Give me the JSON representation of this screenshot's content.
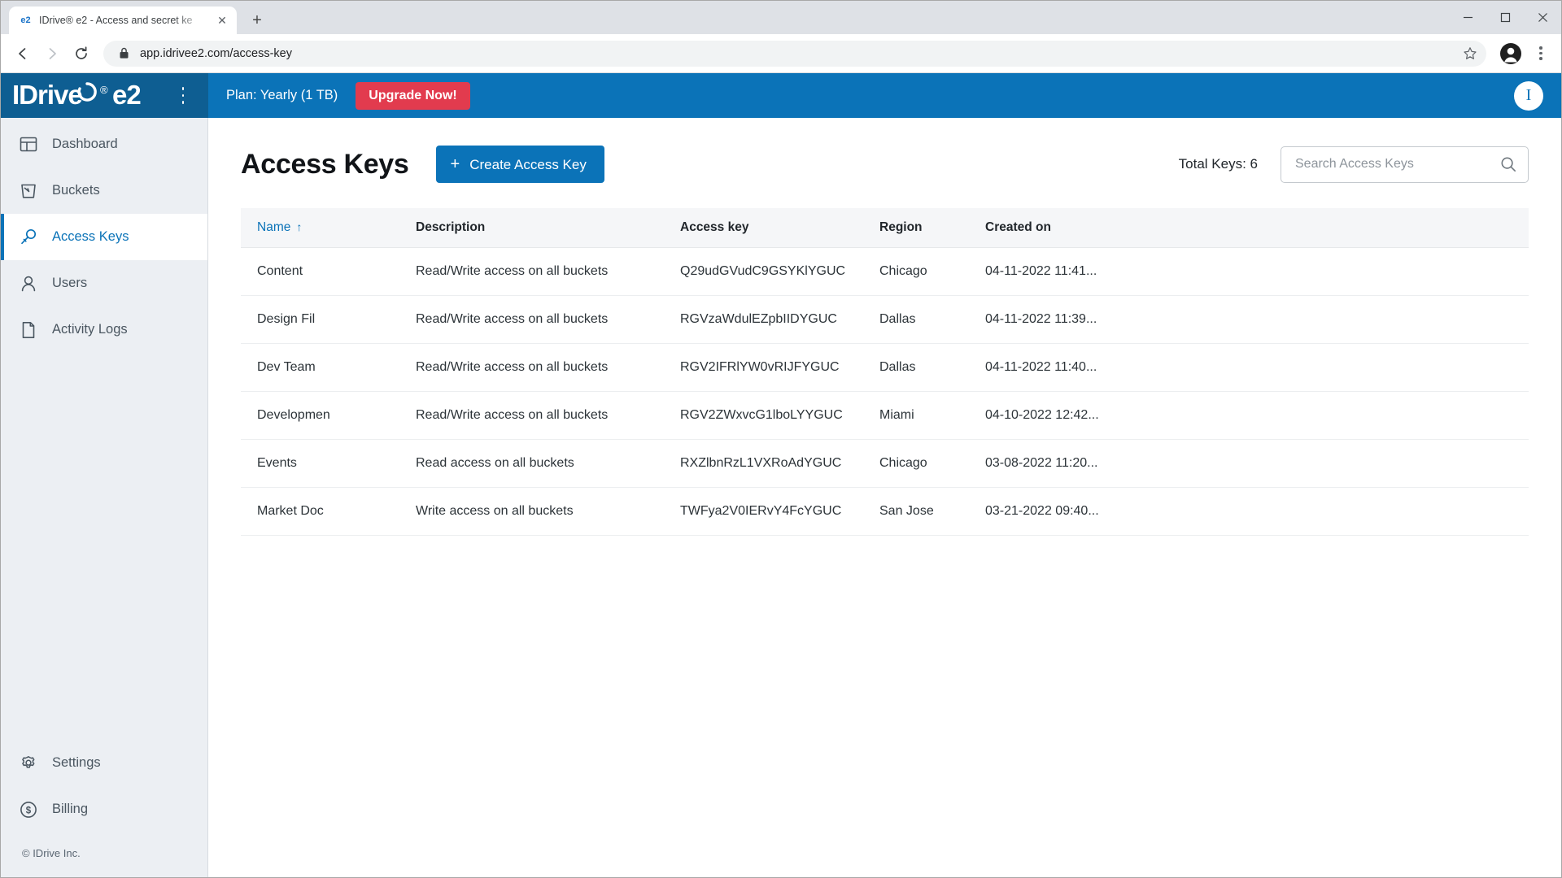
{
  "browser": {
    "tab": {
      "favicon_text": "e2",
      "title": "IDrive® e2 - Access and secret ke",
      "close_label": "✕"
    },
    "new_tab_label": "+",
    "window_controls": {
      "minimize": "—",
      "maximize": "▢",
      "close": "✕"
    },
    "nav": {
      "back": "←",
      "forward": "→",
      "reload": "⟳"
    },
    "url": "app.idrivee2.com/access-key",
    "lock_icon": "lock-icon",
    "bookmark_icon": "star-icon",
    "profile_icon": "profile-avatar-icon",
    "menu_icon": "three-dot-menu-icon"
  },
  "appbar": {
    "logo_text": "IDrive",
    "logo_registered": "®",
    "logo_suffix": "e2",
    "menu_icon": "hamburger-icon",
    "plan_text": "Plan: Yearly (1 TB)",
    "upgrade_label": "Upgrade Now!",
    "avatar_initial": "I",
    "colors": {
      "bar": "#0b73b8",
      "brand_zone": "#0e5e92",
      "upgrade": "#e23b4e"
    }
  },
  "sidebar": {
    "items": [
      {
        "label": "Dashboard",
        "icon": "dashboard-icon",
        "active": false
      },
      {
        "label": "Buckets",
        "icon": "bucket-icon",
        "active": false
      },
      {
        "label": "Access Keys",
        "icon": "key-icon",
        "active": true
      },
      {
        "label": "Users",
        "icon": "user-icon",
        "active": false
      },
      {
        "label": "Activity Logs",
        "icon": "document-icon",
        "active": false
      }
    ],
    "bottom_items": [
      {
        "label": "Settings",
        "icon": "gear-icon"
      },
      {
        "label": "Billing",
        "icon": "dollar-circle-icon"
      }
    ],
    "copyright": "© IDrive Inc."
  },
  "main": {
    "page_title": "Access Keys",
    "create_button": {
      "plus": "+",
      "label": "Create Access Key"
    },
    "total_keys_label": "Total Keys: 6",
    "search": {
      "placeholder": "Search Access Keys",
      "value": "",
      "icon": "search-icon"
    },
    "table": {
      "columns": [
        {
          "key": "name",
          "label": "Name",
          "sorted": true,
          "sort_arrow": "↑"
        },
        {
          "key": "description",
          "label": "Description",
          "sorted": false
        },
        {
          "key": "access_key",
          "label": "Access key",
          "sorted": false
        },
        {
          "key": "region",
          "label": "Region",
          "sorted": false
        },
        {
          "key": "created_on",
          "label": "Created on",
          "sorted": false
        }
      ],
      "rows": [
        {
          "name": "Content",
          "description": "Read/Write access on all buckets",
          "access_key": "Q29udGVudC9GSYKlYGUC",
          "region": "Chicago",
          "created_on": "04-11-2022 11:41..."
        },
        {
          "name": "Design Fil",
          "description": "Read/Write access on all buckets",
          "access_key": "RGVzaWdulEZpbIIDYGUC",
          "region": "Dallas",
          "created_on": "04-11-2022 11:39..."
        },
        {
          "name": "Dev Team",
          "description": "Read/Write access on all buckets",
          "access_key": "RGV2IFRlYW0vRIJFYGUC",
          "region": "Dallas",
          "created_on": "04-11-2022 11:40..."
        },
        {
          "name": "Developmen",
          "description": "Read/Write access on all buckets",
          "access_key": "RGV2ZWxvcG1lboLYYGUC",
          "region": "Miami",
          "created_on": "04-10-2022 12:42..."
        },
        {
          "name": "Events",
          "description": "Read access on all buckets",
          "access_key": "RXZlbnRzL1VXRoAdYGUC",
          "region": "Chicago",
          "created_on": "03-08-2022 11:20..."
        },
        {
          "name": "Market Doc",
          "description": "Write access on all buckets",
          "access_key": "TWFya2V0IERvY4FcYGUC",
          "region": "San Jose",
          "created_on": "03-21-2022 09:40..."
        }
      ]
    }
  }
}
